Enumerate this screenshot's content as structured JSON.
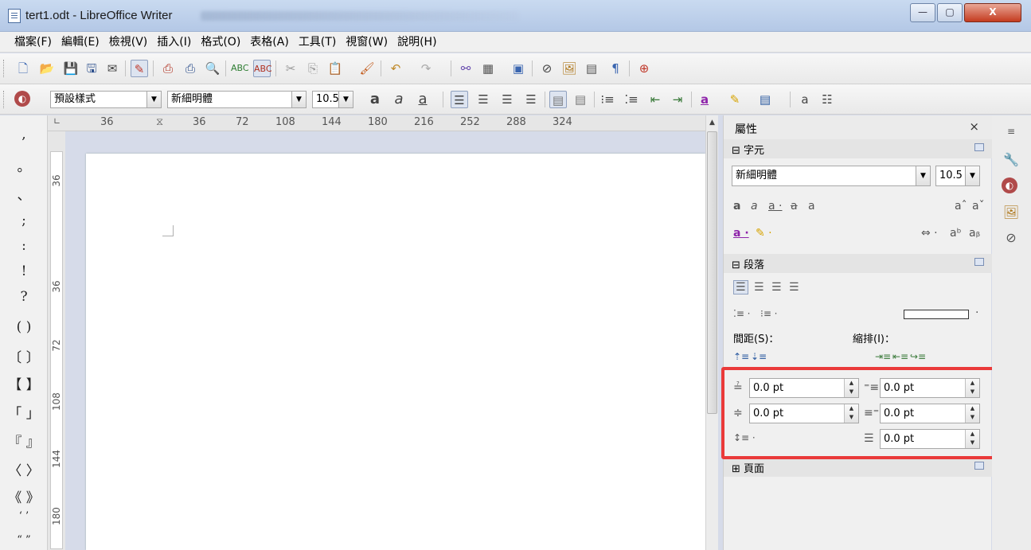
{
  "window": {
    "title": "tert1.odt - LibreOffice Writer",
    "minimize": "—",
    "maximize": "▢",
    "close": "X"
  },
  "menu": [
    "檔案(F)",
    "編輯(E)",
    "檢視(V)",
    "插入(I)",
    "格式(O)",
    "表格(A)",
    "工具(T)",
    "視窗(W)",
    "說明(H)"
  ],
  "formatting": {
    "paragraph_style": "預設樣式",
    "font_name": "新細明體",
    "font_size": "10.5"
  },
  "special_chars": [
    ",",
    "。",
    "、",
    ";",
    ":",
    "!",
    "?",
    "( )",
    "〔 〕",
    "【 】",
    "「 」",
    "『 』",
    "〈 〉",
    "《 》",
    "‘ ’",
    "“ ”"
  ],
  "ruler": {
    "h_marks": [
      "36",
      "36",
      "72",
      "108",
      "144",
      "180",
      "216",
      "252",
      "288",
      "324"
    ],
    "v_marks": [
      "36",
      "36",
      "72",
      "108",
      "144",
      "180"
    ]
  },
  "sidebar": {
    "title": "屬性",
    "close": "×",
    "character": {
      "header": "⊟ 字元",
      "font_name": "新細明體",
      "font_size": "10.5"
    },
    "paragraph": {
      "header": "⊟ 段落",
      "spacing_label": "間距(S)：",
      "indent_label": "縮排(I)：",
      "above_spacing": "0.0 pt",
      "below_spacing": "0.0 pt",
      "before_indent": "0.0 pt",
      "after_indent": "0.0 pt",
      "first_line_indent": "0.0 pt"
    },
    "page": {
      "header": "⊞ 頁面"
    }
  },
  "colors": {
    "highlight": "#ea3a3a",
    "close_button": "#c43b1f"
  }
}
